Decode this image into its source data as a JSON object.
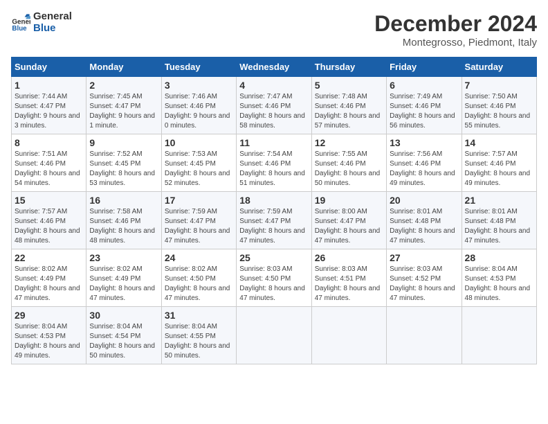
{
  "logo": {
    "line1": "General",
    "line2": "Blue"
  },
  "title": "December 2024",
  "subtitle": "Montegrosso, Piedmont, Italy",
  "days_of_week": [
    "Sunday",
    "Monday",
    "Tuesday",
    "Wednesday",
    "Thursday",
    "Friday",
    "Saturday"
  ],
  "weeks": [
    [
      {
        "day": 1,
        "sunrise": "Sunrise: 7:44 AM",
        "sunset": "Sunset: 4:47 PM",
        "daylight": "Daylight: 9 hours and 3 minutes."
      },
      {
        "day": 2,
        "sunrise": "Sunrise: 7:45 AM",
        "sunset": "Sunset: 4:47 PM",
        "daylight": "Daylight: 9 hours and 1 minute."
      },
      {
        "day": 3,
        "sunrise": "Sunrise: 7:46 AM",
        "sunset": "Sunset: 4:46 PM",
        "daylight": "Daylight: 9 hours and 0 minutes."
      },
      {
        "day": 4,
        "sunrise": "Sunrise: 7:47 AM",
        "sunset": "Sunset: 4:46 PM",
        "daylight": "Daylight: 8 hours and 58 minutes."
      },
      {
        "day": 5,
        "sunrise": "Sunrise: 7:48 AM",
        "sunset": "Sunset: 4:46 PM",
        "daylight": "Daylight: 8 hours and 57 minutes."
      },
      {
        "day": 6,
        "sunrise": "Sunrise: 7:49 AM",
        "sunset": "Sunset: 4:46 PM",
        "daylight": "Daylight: 8 hours and 56 minutes."
      },
      {
        "day": 7,
        "sunrise": "Sunrise: 7:50 AM",
        "sunset": "Sunset: 4:46 PM",
        "daylight": "Daylight: 8 hours and 55 minutes."
      }
    ],
    [
      {
        "day": 8,
        "sunrise": "Sunrise: 7:51 AM",
        "sunset": "Sunset: 4:46 PM",
        "daylight": "Daylight: 8 hours and 54 minutes."
      },
      {
        "day": 9,
        "sunrise": "Sunrise: 7:52 AM",
        "sunset": "Sunset: 4:45 PM",
        "daylight": "Daylight: 8 hours and 53 minutes."
      },
      {
        "day": 10,
        "sunrise": "Sunrise: 7:53 AM",
        "sunset": "Sunset: 4:45 PM",
        "daylight": "Daylight: 8 hours and 52 minutes."
      },
      {
        "day": 11,
        "sunrise": "Sunrise: 7:54 AM",
        "sunset": "Sunset: 4:46 PM",
        "daylight": "Daylight: 8 hours and 51 minutes."
      },
      {
        "day": 12,
        "sunrise": "Sunrise: 7:55 AM",
        "sunset": "Sunset: 4:46 PM",
        "daylight": "Daylight: 8 hours and 50 minutes."
      },
      {
        "day": 13,
        "sunrise": "Sunrise: 7:56 AM",
        "sunset": "Sunset: 4:46 PM",
        "daylight": "Daylight: 8 hours and 49 minutes."
      },
      {
        "day": 14,
        "sunrise": "Sunrise: 7:57 AM",
        "sunset": "Sunset: 4:46 PM",
        "daylight": "Daylight: 8 hours and 49 minutes."
      }
    ],
    [
      {
        "day": 15,
        "sunrise": "Sunrise: 7:57 AM",
        "sunset": "Sunset: 4:46 PM",
        "daylight": "Daylight: 8 hours and 48 minutes."
      },
      {
        "day": 16,
        "sunrise": "Sunrise: 7:58 AM",
        "sunset": "Sunset: 4:46 PM",
        "daylight": "Daylight: 8 hours and 48 minutes."
      },
      {
        "day": 17,
        "sunrise": "Sunrise: 7:59 AM",
        "sunset": "Sunset: 4:47 PM",
        "daylight": "Daylight: 8 hours and 47 minutes."
      },
      {
        "day": 18,
        "sunrise": "Sunrise: 7:59 AM",
        "sunset": "Sunset: 4:47 PM",
        "daylight": "Daylight: 8 hours and 47 minutes."
      },
      {
        "day": 19,
        "sunrise": "Sunrise: 8:00 AM",
        "sunset": "Sunset: 4:47 PM",
        "daylight": "Daylight: 8 hours and 47 minutes."
      },
      {
        "day": 20,
        "sunrise": "Sunrise: 8:01 AM",
        "sunset": "Sunset: 4:48 PM",
        "daylight": "Daylight: 8 hours and 47 minutes."
      },
      {
        "day": 21,
        "sunrise": "Sunrise: 8:01 AM",
        "sunset": "Sunset: 4:48 PM",
        "daylight": "Daylight: 8 hours and 47 minutes."
      }
    ],
    [
      {
        "day": 22,
        "sunrise": "Sunrise: 8:02 AM",
        "sunset": "Sunset: 4:49 PM",
        "daylight": "Daylight: 8 hours and 47 minutes."
      },
      {
        "day": 23,
        "sunrise": "Sunrise: 8:02 AM",
        "sunset": "Sunset: 4:49 PM",
        "daylight": "Daylight: 8 hours and 47 minutes."
      },
      {
        "day": 24,
        "sunrise": "Sunrise: 8:02 AM",
        "sunset": "Sunset: 4:50 PM",
        "daylight": "Daylight: 8 hours and 47 minutes."
      },
      {
        "day": 25,
        "sunrise": "Sunrise: 8:03 AM",
        "sunset": "Sunset: 4:50 PM",
        "daylight": "Daylight: 8 hours and 47 minutes."
      },
      {
        "day": 26,
        "sunrise": "Sunrise: 8:03 AM",
        "sunset": "Sunset: 4:51 PM",
        "daylight": "Daylight: 8 hours and 47 minutes."
      },
      {
        "day": 27,
        "sunrise": "Sunrise: 8:03 AM",
        "sunset": "Sunset: 4:52 PM",
        "daylight": "Daylight: 8 hours and 47 minutes."
      },
      {
        "day": 28,
        "sunrise": "Sunrise: 8:04 AM",
        "sunset": "Sunset: 4:53 PM",
        "daylight": "Daylight: 8 hours and 48 minutes."
      }
    ],
    [
      {
        "day": 29,
        "sunrise": "Sunrise: 8:04 AM",
        "sunset": "Sunset: 4:53 PM",
        "daylight": "Daylight: 8 hours and 49 minutes."
      },
      {
        "day": 30,
        "sunrise": "Sunrise: 8:04 AM",
        "sunset": "Sunset: 4:54 PM",
        "daylight": "Daylight: 8 hours and 50 minutes."
      },
      {
        "day": 31,
        "sunrise": "Sunrise: 8:04 AM",
        "sunset": "Sunset: 4:55 PM",
        "daylight": "Daylight: 8 hours and 50 minutes."
      },
      null,
      null,
      null,
      null
    ]
  ]
}
